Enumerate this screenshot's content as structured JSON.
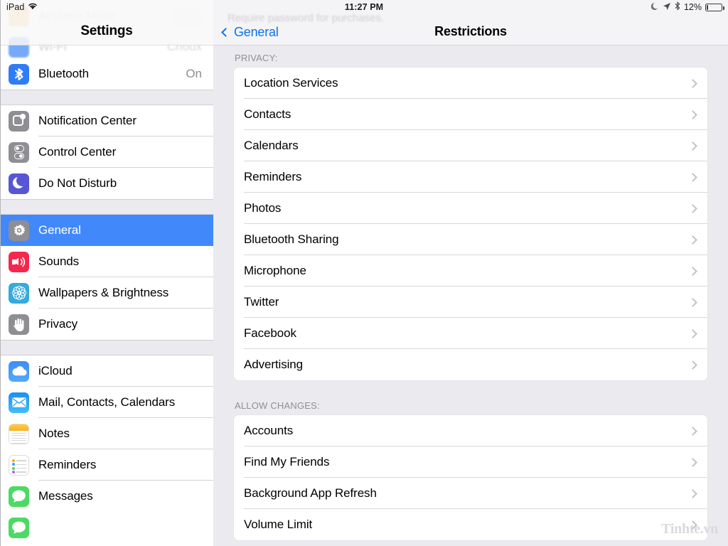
{
  "status_bar": {
    "device": "iPad",
    "wifi_icon": "wifi-icon",
    "time": "11:27 PM",
    "moon_icon": "moon-do-not-disturb-icon",
    "location_icon": "location-arrow-icon",
    "bluetooth_icon": "bluetooth-icon",
    "battery_percent": "12%",
    "battery_icon": "battery-icon"
  },
  "sidebar": {
    "title": "Settings",
    "ghost_rows": [
      {
        "label": "Airplane Mode",
        "value": ""
      },
      {
        "label": "Wi-Fi",
        "value": "Choux"
      }
    ],
    "groups": [
      {
        "items": [
          {
            "label": "Bluetooth",
            "value": "On",
            "icon": "bluetooth-icon",
            "selected": false
          }
        ]
      },
      {
        "items": [
          {
            "label": "Notification Center",
            "value": "",
            "icon": "notification-center-icon",
            "selected": false
          },
          {
            "label": "Control Center",
            "value": "",
            "icon": "control-center-icon",
            "selected": false
          },
          {
            "label": "Do Not Disturb",
            "value": "",
            "icon": "do-not-disturb-icon",
            "selected": false
          }
        ]
      },
      {
        "items": [
          {
            "label": "General",
            "value": "",
            "icon": "gear-icon",
            "selected": true
          },
          {
            "label": "Sounds",
            "value": "",
            "icon": "speaker-icon",
            "selected": false
          },
          {
            "label": "Wallpapers & Brightness",
            "value": "",
            "icon": "flower-icon",
            "selected": false
          },
          {
            "label": "Privacy",
            "value": "",
            "icon": "hand-icon",
            "selected": false
          }
        ]
      },
      {
        "items": [
          {
            "label": "iCloud",
            "value": "",
            "icon": "cloud-icon",
            "selected": false
          },
          {
            "label": "Mail, Contacts, Calendars",
            "value": "",
            "icon": "envelope-icon",
            "selected": false
          },
          {
            "label": "Notes",
            "value": "",
            "icon": "notes-icon",
            "selected": false
          },
          {
            "label": "Reminders",
            "value": "",
            "icon": "reminders-icon",
            "selected": false
          },
          {
            "label": "Messages",
            "value": "",
            "icon": "messages-icon",
            "selected": false
          }
        ]
      }
    ]
  },
  "detail": {
    "back_label": "General",
    "back_icon": "chevron-left-icon",
    "title": "Restrictions",
    "ghost_text": "Require password for purchases.",
    "sections": [
      {
        "header": "PRIVACY:",
        "rows": [
          {
            "label": "Location Services",
            "accessory": "chevron-right-icon"
          },
          {
            "label": "Contacts",
            "accessory": "chevron-right-icon"
          },
          {
            "label": "Calendars",
            "accessory": "chevron-right-icon"
          },
          {
            "label": "Reminders",
            "accessory": "chevron-right-icon"
          },
          {
            "label": "Photos",
            "accessory": "chevron-right-icon"
          },
          {
            "label": "Bluetooth Sharing",
            "accessory": "chevron-right-icon"
          },
          {
            "label": "Microphone",
            "accessory": "chevron-right-icon"
          },
          {
            "label": "Twitter",
            "accessory": "chevron-right-icon"
          },
          {
            "label": "Facebook",
            "accessory": "chevron-right-icon"
          },
          {
            "label": "Advertising",
            "accessory": "chevron-right-icon"
          }
        ]
      },
      {
        "header": "ALLOW CHANGES:",
        "rows": [
          {
            "label": "Accounts",
            "accessory": "chevron-right-icon"
          },
          {
            "label": "Find My Friends",
            "accessory": "chevron-right-icon"
          },
          {
            "label": "Background App Refresh",
            "accessory": "chevron-right-icon"
          },
          {
            "label": "Volume Limit",
            "accessory": "chevron-right-icon"
          }
        ]
      }
    ]
  },
  "watermark": "Tinhte.vn",
  "colors": {
    "accent_blue": "#4189fb",
    "link_blue": "#0b72ee",
    "panel_bg": "#eaeaef",
    "row_bg": "#ffffff",
    "secondary_text": "#8e8e93"
  }
}
